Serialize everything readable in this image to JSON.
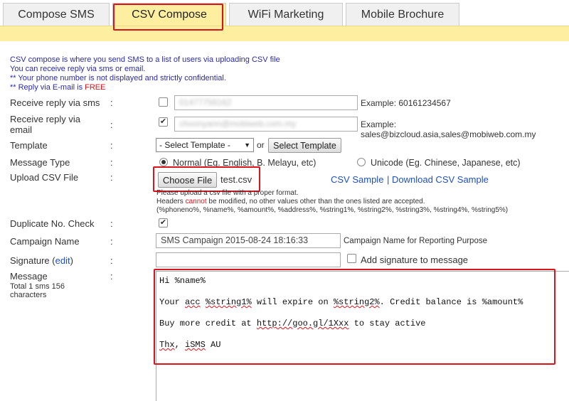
{
  "tabs": [
    {
      "label": "Compose SMS"
    },
    {
      "label": "CSV Compose"
    },
    {
      "label": "WiFi Marketing"
    },
    {
      "label": "Mobile Brochure"
    }
  ],
  "intro": {
    "line1": "CSV compose is where you send SMS to a list of users via uploading CSV file",
    "line2": "You can receive reply via sms or email.",
    "line3": "** Your phone number is not displayed and strictly confidential.",
    "line4_prefix": "** Reply via E-mail is ",
    "line4_free": "FREE"
  },
  "form": {
    "colon": ":",
    "reply_sms": {
      "label": "Receive reply via sms",
      "checked": false,
      "value": "0147775616​2",
      "example": "Example: 60161234567"
    },
    "reply_email": {
      "label_line1": "Receive reply via",
      "label_line2": "email",
      "checked": true,
      "value": "choonyann@mobiweb.com.my",
      "example": "Example: sales@bizcloud.asia,sales@mobiweb.com.my"
    },
    "template": {
      "label": "Template",
      "select_value": "- Select Template -",
      "arrow": "▼",
      "or": "or",
      "button": "Select Template"
    },
    "message_type": {
      "label": "Message Type",
      "normal_label": "Normal (Eg. English, B. Melayu, etc)",
      "unicode_label": "Unicode (Eg. Chinese, Japanese, etc)",
      "selected": "normal"
    },
    "upload": {
      "label": "Upload CSV File",
      "button": "Choose File",
      "filename": "test.csv",
      "csv_sample": "CSV Sample",
      "separator": "|",
      "download_sample": "Download CSV Sample",
      "note1": "Please upload a csv file with a proper format.",
      "note2_prefix": "Headers ",
      "note2_cannot": "cannot",
      "note2_suffix": " be modified, no other values other than the ones listed are accepted.",
      "note3": "(%phoneno%, %name%, %amount%, %address%, %string1%, %string2%, %string3%, %string4%, %string5%)"
    },
    "duplicate": {
      "label": "Duplicate No. Check",
      "checked": true
    },
    "campaign": {
      "label": "Campaign Name",
      "value": "SMS Campaign 2015-08-24 18:16:33",
      "hint": "Campaign Name for Reporting Purpose"
    },
    "signature": {
      "label": "Signature",
      "edit_open": "(",
      "edit_link": "edit",
      "edit_close": ")",
      "value": "",
      "add_label": "Add signature to message",
      "checked": false
    },
    "message": {
      "label": "Message",
      "count_line1": "Total 1 sms 156",
      "count_line2": "characters",
      "line1": "Hi %name%",
      "line2_a": "Your ",
      "line2_b": "acc",
      "line2_c": " ",
      "line2_d": "%string1%",
      "line2_e": " will expire on ",
      "line2_f": "%string2%",
      "line2_g": ". Credit balance is %amount%",
      "line3_a": "Buy more credit at ",
      "line3_b": "http://goo.gl/1Xxx",
      "line3_c": " to stay active",
      "line4_a": "Thx",
      "line4_b": ", ",
      "line4_c": "iSMS",
      "line4_d": " AU"
    }
  },
  "colors": {
    "accent_band": "#fdeea0",
    "highlight_box": "#d9141c",
    "link": "#1f4fc1",
    "intro_text": "#2a2aa8"
  }
}
